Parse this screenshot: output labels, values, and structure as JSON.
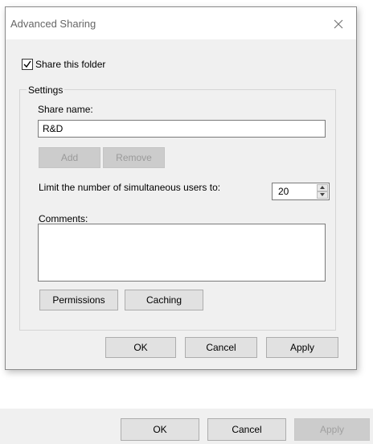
{
  "background_window": {
    "buttons": {
      "ok": "OK",
      "cancel": "Cancel",
      "apply": "Apply"
    }
  },
  "dialog": {
    "title": "Advanced Sharing",
    "close_icon": "close-icon",
    "share_checkbox": {
      "label": "Share this folder",
      "checked": true
    },
    "settings_group_label": "Settings",
    "share_name_label": "Share name:",
    "share_name_value": "R&D",
    "add_button": "Add",
    "remove_button": "Remove",
    "limit_label": "Limit the number of simultaneous users to:",
    "limit_value": "20",
    "comments_label": "Comments:",
    "comments_value": "",
    "permissions_button": "Permissions",
    "caching_button": "Caching",
    "ok_button": "OK",
    "cancel_button": "Cancel",
    "apply_button": "Apply"
  }
}
